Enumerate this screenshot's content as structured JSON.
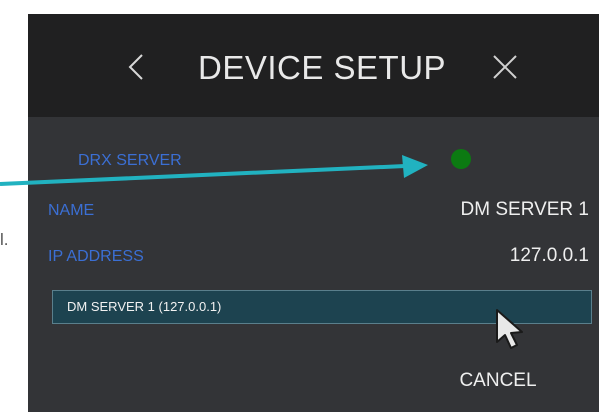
{
  "window": {
    "title": "DEVICE SETUP",
    "back_icon": "chevron-left-icon",
    "close_icon": "close-icon"
  },
  "fields": {
    "drx_server_label": "DRX SERVER",
    "drx_server_status_color": "#0c7a12",
    "name_label": "NAME",
    "name_value": "DM SERVER 1",
    "ip_label": "IP ADDRESS",
    "ip_value": "127.0.0.1"
  },
  "server_list": {
    "selected": "DM SERVER 1 (127.0.0.1)"
  },
  "actions": {
    "cancel_label": "CANCEL"
  },
  "background_text": {
    "partial": "l."
  },
  "colors": {
    "panel_bg": "#333437",
    "header_bg": "#202021",
    "label_blue": "#3b6fd4",
    "selection_bg": "#1d4350",
    "annotation_arrow": "#21b2c0"
  }
}
